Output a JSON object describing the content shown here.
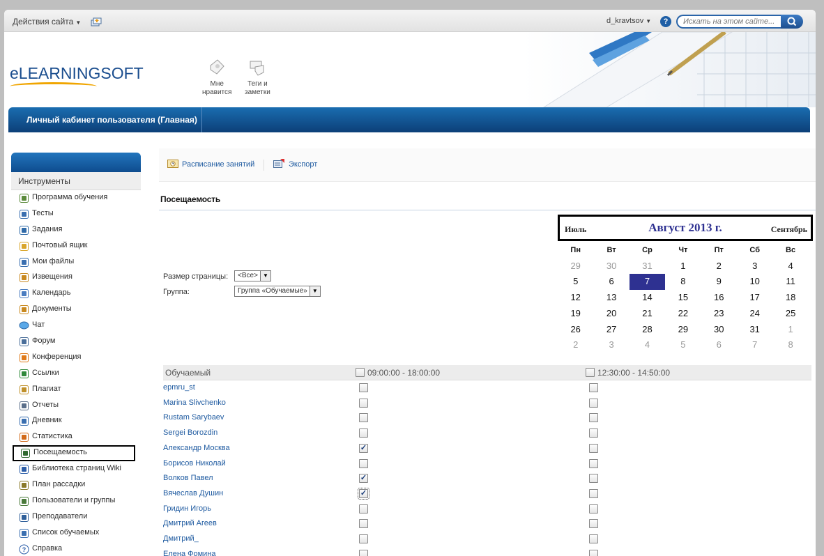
{
  "topbar": {
    "site_actions": "Действия сайта",
    "user": "d_kravtsov",
    "search_placeholder": "Искать на этом сайте..."
  },
  "header": {
    "logo_text": "eLEARNINGSOFT",
    "tools": [
      {
        "label_line1": "Мне",
        "label_line2": "нравится"
      },
      {
        "label_line1": "Теги и",
        "label_line2": "заметки"
      }
    ]
  },
  "nav": {
    "main_tab": "Личный кабинет пользователя (Главная)"
  },
  "sidebar": {
    "title": "Инструменты",
    "items": [
      {
        "label": "Программа обучения",
        "icon": "tree-icon"
      },
      {
        "label": "Тесты",
        "icon": "test-icon"
      },
      {
        "label": "Задания",
        "icon": "tasks-icon"
      },
      {
        "label": "Почтовый ящик",
        "icon": "mailbox-icon"
      },
      {
        "label": "Мои файлы",
        "icon": "folder-icon"
      },
      {
        "label": "Извещения",
        "icon": "megaphone-icon"
      },
      {
        "label": "Календарь",
        "icon": "calendar-icon"
      },
      {
        "label": "Документы",
        "icon": "documents-icon"
      },
      {
        "label": "Чат",
        "icon": "chat-icon"
      },
      {
        "label": "Форум",
        "icon": "forum-icon"
      },
      {
        "label": "Конференция",
        "icon": "conference-icon"
      },
      {
        "label": "Ссылки",
        "icon": "links-icon"
      },
      {
        "label": "Плагиат",
        "icon": "plagiarism-icon"
      },
      {
        "label": "Отчеты",
        "icon": "reports-icon"
      },
      {
        "label": "Дневник",
        "icon": "diary-icon"
      },
      {
        "label": "Статистика",
        "icon": "statistics-icon"
      },
      {
        "label": "Посещаемость",
        "icon": "attendance-icon"
      },
      {
        "label": "Библиотека страниц Wiki",
        "icon": "wiki-icon"
      },
      {
        "label": "План рассадки",
        "icon": "seating-icon"
      },
      {
        "label": "Пользователи и группы",
        "icon": "users-icon"
      },
      {
        "label": "Преподаватели",
        "icon": "teachers-icon"
      },
      {
        "label": "Список обучаемых",
        "icon": "learners-icon"
      },
      {
        "label": "Справка",
        "icon": "help-icon"
      }
    ],
    "active_index": 16
  },
  "toolbar": {
    "schedule": "Расписание занятий",
    "export": "Экспорт"
  },
  "main": {
    "title": "Посещаемость",
    "filters": {
      "page_size_label": "Размер страницы:",
      "page_size_value": "<Все>",
      "group_label": "Группа:",
      "group_value": "Группа «Обучаемые»"
    }
  },
  "calendar": {
    "prev": "Июль",
    "title": "Август 2013 г.",
    "next": "Сентябрь",
    "weekdays": [
      "Пн",
      "Вт",
      "Ср",
      "Чт",
      "Пт",
      "Сб",
      "Вс"
    ],
    "weeks": [
      [
        "29",
        "30",
        "31",
        "1",
        "2",
        "3",
        "4"
      ],
      [
        "5",
        "6",
        "7",
        "8",
        "9",
        "10",
        "11"
      ],
      [
        "12",
        "13",
        "14",
        "15",
        "16",
        "17",
        "18"
      ],
      [
        "19",
        "20",
        "21",
        "22",
        "23",
        "24",
        "25"
      ],
      [
        "26",
        "27",
        "28",
        "29",
        "30",
        "31",
        "1"
      ],
      [
        "2",
        "3",
        "4",
        "5",
        "6",
        "7",
        "8"
      ]
    ],
    "selected_day": "7",
    "accent": "#2e3191"
  },
  "attendance": {
    "col_learner": "Обучаемый",
    "col_slot1": "09:00:00 - 18:00:00",
    "col_slot2": "12:30:00 - 14:50:00",
    "rows": [
      {
        "name": "epmru_st",
        "slot1": false,
        "slot2": false
      },
      {
        "name": "Marina Slivchenko",
        "slot1": false,
        "slot2": false
      },
      {
        "name": "Rustam Sarybaev",
        "slot1": false,
        "slot2": false
      },
      {
        "name": "Sergei Borozdin",
        "slot1": false,
        "slot2": false
      },
      {
        "name": "Александр Москва",
        "slot1": true,
        "slot2": false
      },
      {
        "name": "Борисов Николай",
        "slot1": false,
        "slot2": false
      },
      {
        "name": "Волков Павел",
        "slot1": true,
        "slot2": false
      },
      {
        "name": "Вячеслав Душин",
        "slot1": true,
        "slot2": false,
        "focused": true
      },
      {
        "name": "Гридин Игорь",
        "slot1": false,
        "slot2": false
      },
      {
        "name": "Дмитрий Агеев",
        "slot1": false,
        "slot2": false
      },
      {
        "name": "Дмитрий_",
        "slot1": false,
        "slot2": false
      },
      {
        "name": "Елена Фомина",
        "slot1": false,
        "slot2": false
      }
    ]
  }
}
